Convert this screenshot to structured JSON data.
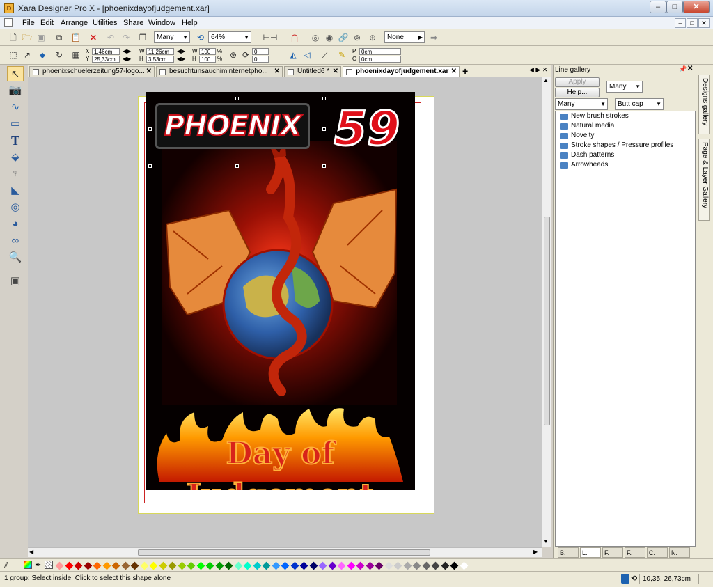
{
  "window": {
    "title": "Xara Designer Pro X - [phoenixdayofjudgement.xar]",
    "app_icon_letter": "D",
    "btn_min": "–",
    "btn_max": "□",
    "btn_close": "✕"
  },
  "menu": {
    "items": [
      "File",
      "Edit",
      "Arrange",
      "Utilities",
      "Share",
      "Window",
      "Help"
    ]
  },
  "toolbar1": {
    "selector_value": "Many",
    "zoom_value": "64%",
    "feather_value": "None"
  },
  "toolbar2": {
    "x_label": "X",
    "x_value": "1,46cm",
    "y_label": "Y",
    "y_value": "25,33cm",
    "w_label": "W",
    "w_value": "11,26cm",
    "h_label": "H",
    "h_value": "3,53cm",
    "sw_value": "100",
    "sh_value": "100",
    "pct": "%",
    "rot_value": "0",
    "skew_value": "0",
    "p_label": "P",
    "p_value": "0cm",
    "o_label": "O",
    "o_value": "0cm"
  },
  "tabs": [
    {
      "label": "phoenixschuelerzeitung57-logo...",
      "active": false
    },
    {
      "label": "besuchtunsauchiminternetpho...",
      "active": false
    },
    {
      "label": "Untitled6 *",
      "active": false
    },
    {
      "label": "phoenixdayofjudgement.xar",
      "active": true
    }
  ],
  "tab_close": "✕",
  "tab_add": "+",
  "artwork": {
    "logo_text": "PHOENIX",
    "issue_number": "59",
    "headline": "Day of Judgement"
  },
  "line_gallery": {
    "title": "Line gallery",
    "apply_label": "Apply",
    "help_label": "Help...",
    "combo1": "Many",
    "combo2": "Many",
    "combo3": "Butt cap",
    "items": [
      "New brush strokes",
      "Natural media",
      "Novelty",
      "Stroke shapes / Pressure profiles",
      "Dash patterns",
      "Arrowheads"
    ],
    "bottom_tabs": [
      "B.",
      "L.",
      "F.",
      "F.",
      "C.",
      "N."
    ]
  },
  "side_tabs": [
    "Designs gallery",
    "Page & Layer Gallery"
  ],
  "status": {
    "text": "1 group: Select inside; Click to select this shape alone",
    "coords": "10,35, 26,73cm"
  },
  "colors": {
    "palette": [
      "#ff9999",
      "#ff0000",
      "#cc0000",
      "#990000",
      "#ff6600",
      "#ff9900",
      "#cc6600",
      "#996633",
      "#663300",
      "#ffff66",
      "#ffff00",
      "#cccc00",
      "#999900",
      "#99cc00",
      "#66cc00",
      "#00ff00",
      "#00cc00",
      "#009900",
      "#006600",
      "#66ffcc",
      "#00ffcc",
      "#00cccc",
      "#009999",
      "#3399ff",
      "#0066ff",
      "#0033cc",
      "#000099",
      "#000066",
      "#9966ff",
      "#6600cc",
      "#ff66ff",
      "#ff00ff",
      "#cc00cc",
      "#990099",
      "#660066",
      "#dddddd",
      "#cccccc",
      "#aaaaaa",
      "#888888",
      "#666666",
      "#444444",
      "#222222",
      "#000000",
      "#ffffff"
    ]
  }
}
